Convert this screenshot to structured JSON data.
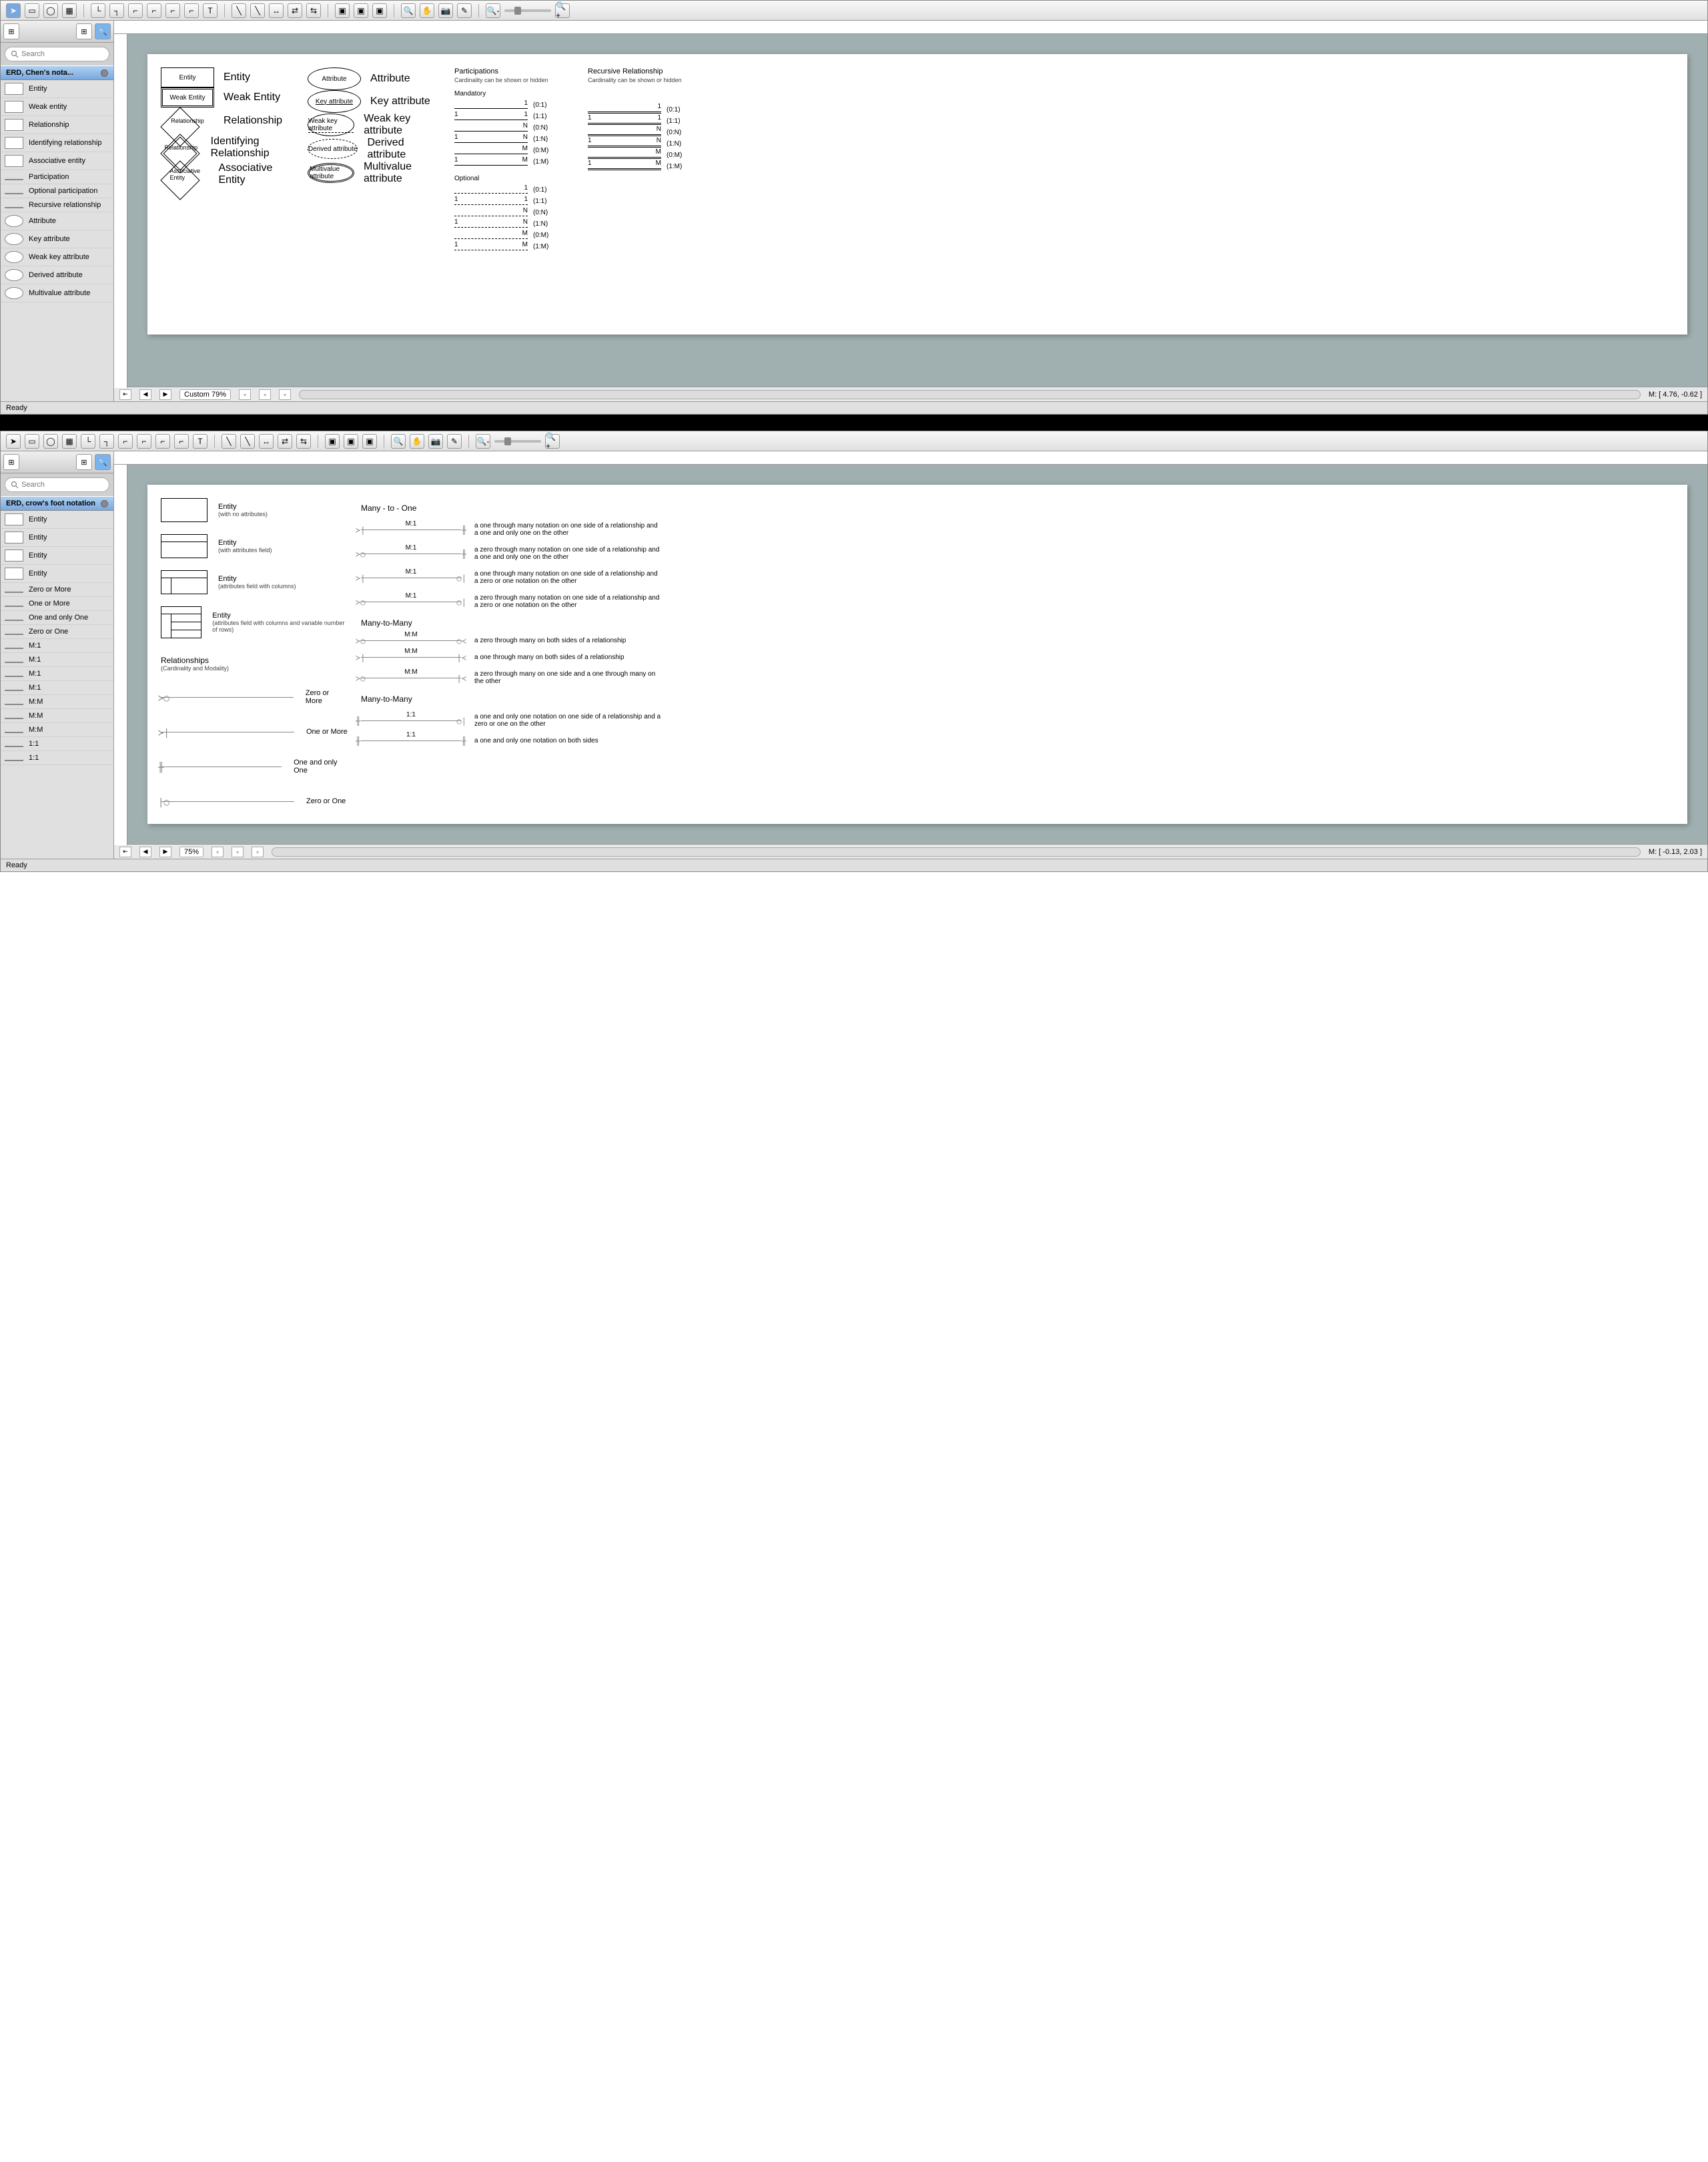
{
  "window1": {
    "search_placeholder": "Search",
    "panel_title": "ERD, Chen's nota...",
    "shapes": [
      {
        "label": "Entity",
        "type": "rect"
      },
      {
        "label": "Weak entity",
        "type": "rect"
      },
      {
        "label": "Relationship",
        "type": "diamond"
      },
      {
        "label": "Identifying relationship",
        "type": "diamond"
      },
      {
        "label": "Associative entity",
        "type": "diamond"
      },
      {
        "label": "Participation",
        "type": "line"
      },
      {
        "label": "Optional participation",
        "type": "line"
      },
      {
        "label": "Recursive relationship",
        "type": "line"
      },
      {
        "label": "Attribute",
        "type": "ellipse"
      },
      {
        "label": "Key attribute",
        "type": "ellipse"
      },
      {
        "label": "Weak key attribute",
        "type": "ellipse"
      },
      {
        "label": "Derived attribute",
        "type": "ellipse"
      },
      {
        "label": "Multivalue attribute",
        "type": "ellipse"
      }
    ],
    "canvas": {
      "col1": [
        {
          "shape_text": "Entity",
          "label": "Entity"
        },
        {
          "shape_text": "Weak Entity",
          "label": "Weak Entity"
        },
        {
          "shape_text": "Relationship",
          "label": "Relationship"
        },
        {
          "shape_text": "Relationship",
          "label": "Identifying Relationship"
        },
        {
          "shape_text": "Associative Entity",
          "label": "Associative Entity"
        }
      ],
      "col2": [
        {
          "shape_text": "Attribute",
          "label": "Attribute"
        },
        {
          "shape_text": "Key attribute",
          "label": "Key attribute"
        },
        {
          "shape_text": "Weak key attribute",
          "label": "Weak key attribute"
        },
        {
          "shape_text": "Derived attribute",
          "label": "Derived attribute"
        },
        {
          "shape_text": "Multivalue attribute",
          "label": "Multivalue attribute"
        }
      ],
      "participations_title": "Participations",
      "participations_sub": "Cardinality can be shown or hidden",
      "mandatory_title": "Mandatory",
      "mandatory_lines": [
        {
          "l": "",
          "r": "1",
          "ratio": "(0:1)"
        },
        {
          "l": "1",
          "r": "1",
          "ratio": "(1:1)"
        },
        {
          "l": "",
          "r": "N",
          "ratio": "(0:N)"
        },
        {
          "l": "1",
          "r": "N",
          "ratio": "(1:N)"
        },
        {
          "l": "",
          "r": "M",
          "ratio": "(0:M)"
        },
        {
          "l": "1",
          "r": "M",
          "ratio": "(1:M)"
        }
      ],
      "optional_title": "Optional",
      "optional_lines": [
        {
          "l": "",
          "r": "1",
          "ratio": "(0:1)"
        },
        {
          "l": "1",
          "r": "1",
          "ratio": "(1:1)"
        },
        {
          "l": "",
          "r": "N",
          "ratio": "(0:N)"
        },
        {
          "l": "1",
          "r": "N",
          "ratio": "(1:N)"
        },
        {
          "l": "",
          "r": "M",
          "ratio": "(0:M)"
        },
        {
          "l": "1",
          "r": "M",
          "ratio": "(1:M)"
        }
      ],
      "recursive_title": "Recursive Relationship",
      "recursive_sub": "Cardinality can be shown or hidden",
      "recursive_lines": [
        {
          "l": "",
          "r": "1",
          "ratio": "(0:1)"
        },
        {
          "l": "1",
          "r": "1",
          "ratio": "(1:1)"
        },
        {
          "l": "",
          "r": "N",
          "ratio": "(0:N)"
        },
        {
          "l": "1",
          "r": "N",
          "ratio": "(1:N)"
        },
        {
          "l": "",
          "r": "M",
          "ratio": "(0:M)"
        },
        {
          "l": "1",
          "r": "M",
          "ratio": "(1:M)"
        }
      ]
    },
    "footer": {
      "zoom": "Custom 79%",
      "coords": "M: [ 4.76, -0.62 ]"
    },
    "status": "Ready"
  },
  "window2": {
    "search_placeholder": "Search",
    "panel_title": "ERD, crow's foot notation",
    "shapes": [
      {
        "label": "Entity",
        "type": "rect"
      },
      {
        "label": "Entity",
        "type": "rect"
      },
      {
        "label": "Entity",
        "type": "rect"
      },
      {
        "label": "Entity",
        "type": "rect"
      },
      {
        "label": "Zero or More",
        "type": "line"
      },
      {
        "label": "One or More",
        "type": "line"
      },
      {
        "label": "One and only One",
        "type": "line"
      },
      {
        "label": "Zero or One",
        "type": "line"
      },
      {
        "label": "M:1",
        "type": "line"
      },
      {
        "label": "M:1",
        "type": "line"
      },
      {
        "label": "M:1",
        "type": "line"
      },
      {
        "label": "M:1",
        "type": "line"
      },
      {
        "label": "M:M",
        "type": "line"
      },
      {
        "label": "M:M",
        "type": "line"
      },
      {
        "label": "M:M",
        "type": "line"
      },
      {
        "label": "1:1",
        "type": "line"
      },
      {
        "label": "1:1",
        "type": "line"
      }
    ],
    "canvas": {
      "entities": [
        {
          "title": "Entity",
          "sub": "(with no attributes)"
        },
        {
          "title": "Entity",
          "sub": "(with attributes field)"
        },
        {
          "title": "Entity",
          "sub": "(attributes field with columns)"
        },
        {
          "title": "Entity",
          "sub": "(attributes field with columns and variable number of rows)"
        }
      ],
      "rel_title": "Relationships",
      "rel_sub": "(Cardinality and Modality)",
      "cardinality_lines": [
        {
          "left": "≻○",
          "right": "",
          "label": "Zero or More"
        },
        {
          "left": "≻|",
          "right": "",
          "label": "One or More"
        },
        {
          "left": "╫",
          "right": "",
          "label": "One and only One"
        },
        {
          "left": "|○",
          "right": "",
          "label": "Zero or One"
        }
      ],
      "sections": [
        {
          "title": "Many - to - One",
          "rows": [
            {
              "l": "≻|",
              "r": "╫",
              "lbl": "M:1",
              "desc": "a one through many notation on one side of a relationship and a one and only one on the other"
            },
            {
              "l": "≻○",
              "r": "╫",
              "lbl": "M:1",
              "desc": "a zero through many notation on one side of a relationship and a one and only one on the other"
            },
            {
              "l": "≻|",
              "r": "○|",
              "lbl": "M:1",
              "desc": "a one through many notation on one side of a relationship and a zero or one notation on the other"
            },
            {
              "l": "≻○",
              "r": "○|",
              "lbl": "M:1",
              "desc": "a zero through many notation on one side of a relationship and a zero or one notation on the other"
            }
          ]
        },
        {
          "title": "Many-to-Many",
          "rows": [
            {
              "l": "≻○",
              "r": "○≺",
              "lbl": "M:M",
              "desc": "a zero through many on both sides of a relationship"
            },
            {
              "l": "≻|",
              "r": "|≺",
              "lbl": "M:M",
              "desc": "a one through many on both sides of a relationship"
            },
            {
              "l": "≻○",
              "r": "|≺",
              "lbl": "M:M",
              "desc": "a zero through many on one side and a one through many on the other"
            }
          ]
        },
        {
          "title": "Many-to-Many",
          "rows": [
            {
              "l": "╫",
              "r": "○|",
              "lbl": "1:1",
              "desc": "a one and only one notation on one side of a relationship and a zero or one on the other"
            },
            {
              "l": "╫",
              "r": "╫",
              "lbl": "1:1",
              "desc": "a one and only one notation on both sides"
            }
          ]
        }
      ]
    },
    "footer": {
      "zoom": "75%",
      "coords": "M: [ -0.13, 2.03 ]"
    },
    "status": "Ready"
  }
}
